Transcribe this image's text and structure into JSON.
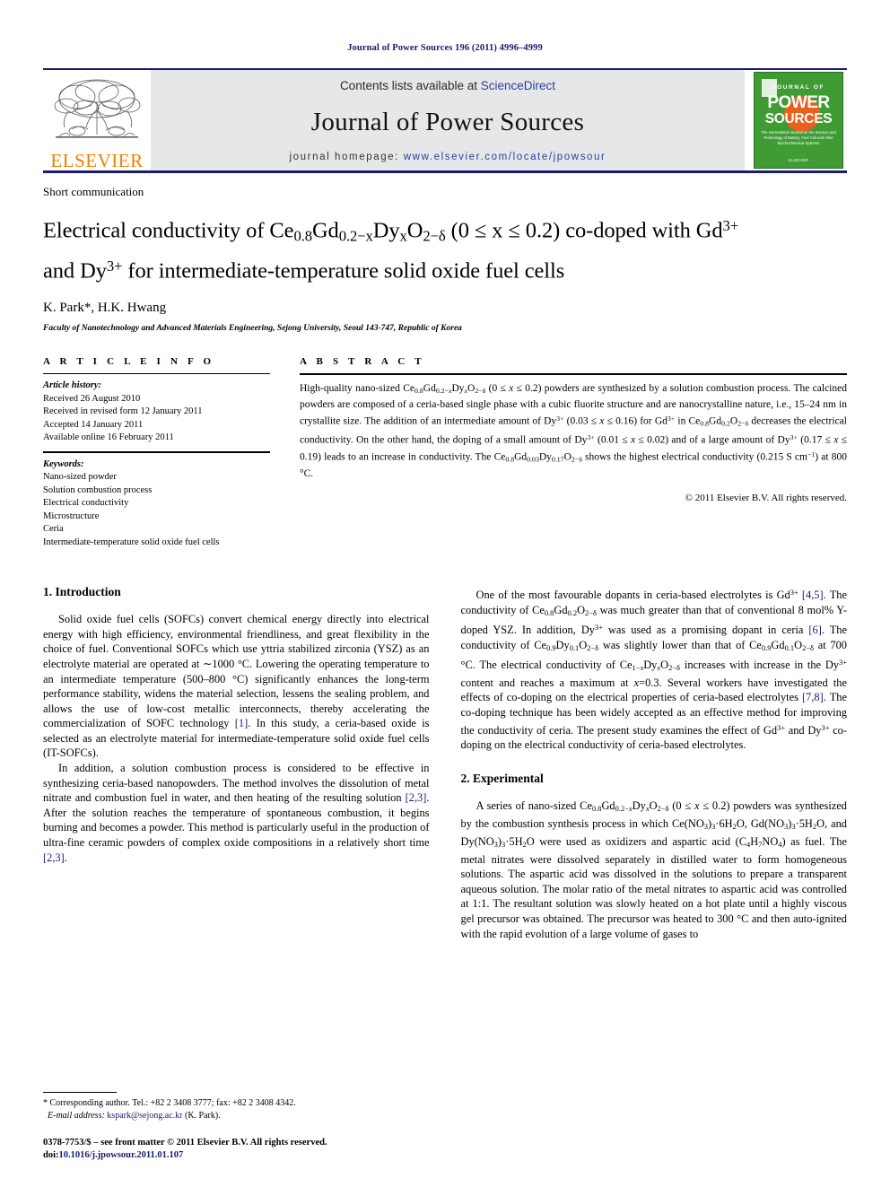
{
  "running_head": "Journal of Power Sources 196 (2011) 4996–4999",
  "masthead": {
    "elsevier_wordmark": "ELSEVIER",
    "contents_prefix": "Contents lists available at ",
    "sciencedirect": "ScienceDirect",
    "journal_title": "Journal of Power Sources",
    "homepage_prefix": "journal homepage: ",
    "homepage_url": "www.elsevier.com/locate/jpowsour",
    "cover": {
      "journal_of": "JOURNAL OF",
      "power": "POWER",
      "sources": "SOURCES",
      "subtitle": "The International Journal on the Science and Technology of Battery, Fuel Cell and other Electrochemical Systems",
      "footer": "ELSEVIER"
    },
    "accent_blue": "#1b1b6f",
    "accent_orange": "#f08000",
    "cover_green": "#3f9c35"
  },
  "article": {
    "type": "Short communication",
    "title_line1_parts": {
      "a": "Electrical conductivity of Ce",
      "sub1": "0.8",
      "b": "Gd",
      "sub2": "0.2−x",
      "c": "Dy",
      "sub3": "x",
      "d": "O",
      "sub4": "2−δ",
      "e": " (0 ≤ x ≤ 0.2) co-doped with Gd",
      "sup1": "3+"
    },
    "title_line2_parts": {
      "a": "and Dy",
      "sup1": "3+",
      "b": " for intermediate-temperature solid oxide fuel cells"
    },
    "authors": "K. Park*, H.K. Hwang",
    "affiliation": "Faculty of Nanotechnology and Advanced Materials Engineering, Sejong University, Seoul 143-747, Republic of Korea"
  },
  "article_info": {
    "heading": "A R T I C L E  I N F O",
    "history_label": "Article history:",
    "history": [
      "Received 26 August 2010",
      "Received in revised form 12 January 2011",
      "Accepted 14 January 2011",
      "Available online 16 February 2011"
    ],
    "keywords_label": "Keywords:",
    "keywords": [
      "Nano-sized powder",
      "Solution combustion process",
      "Electrical conductivity",
      "Microstructure",
      "Ceria",
      "Intermediate-temperature solid oxide fuel cells"
    ]
  },
  "abstract": {
    "heading": "A B S T R A C T",
    "copyright": "© 2011 Elsevier B.V. All rights reserved."
  },
  "sections": {
    "intro_heading": "1.  Introduction",
    "experimental_heading": "2.  Experimental"
  },
  "footnote": {
    "corresponding": "* Corresponding author. Tel.: +82 2 3408 3777; fax: +82 2 3408 4342.",
    "email_label": "E-mail address:",
    "email": "kspark@sejong.ac.kr",
    "email_suffix": " (K. Park).",
    "imprint": "0378-7753/$ – see front matter © 2011 Elsevier B.V. All rights reserved.",
    "doi_label": "doi:",
    "doi": "10.1016/j.jpowsour.2011.01.107"
  }
}
